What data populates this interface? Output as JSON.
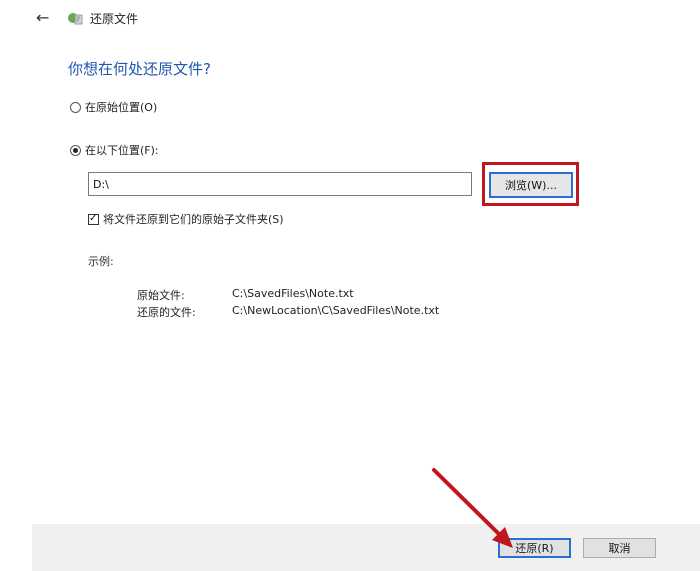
{
  "window": {
    "title": "还原文件",
    "back_icon": "back-arrow-icon",
    "app_icon": "file-history-icon"
  },
  "heading": "你想在何处还原文件?",
  "options": {
    "original_location": {
      "label": "在原始位置(O)",
      "selected": false
    },
    "following_location": {
      "label": "在以下位置(F):",
      "selected": true
    }
  },
  "path_input": {
    "value": "D:\\"
  },
  "browse_button": {
    "label": "浏览(W)..."
  },
  "preserve_structure": {
    "label": "将文件还原到它们的原始子文件夹(S)",
    "checked": true
  },
  "example": {
    "label": "示例:",
    "original_key": "原始文件:",
    "original_value": "C:\\SavedFiles\\Note.txt",
    "restored_key": "还原的文件:",
    "restored_value": "C:\\NewLocation\\C\\SavedFiles\\Note.txt"
  },
  "footer": {
    "restore_label": "还原(R)",
    "cancel_label": "取消"
  },
  "colors": {
    "heading": "#1f57b0",
    "highlight": "#c0161e",
    "focus": "#2a6fd6",
    "footer_bg": "#f0f0f0"
  }
}
